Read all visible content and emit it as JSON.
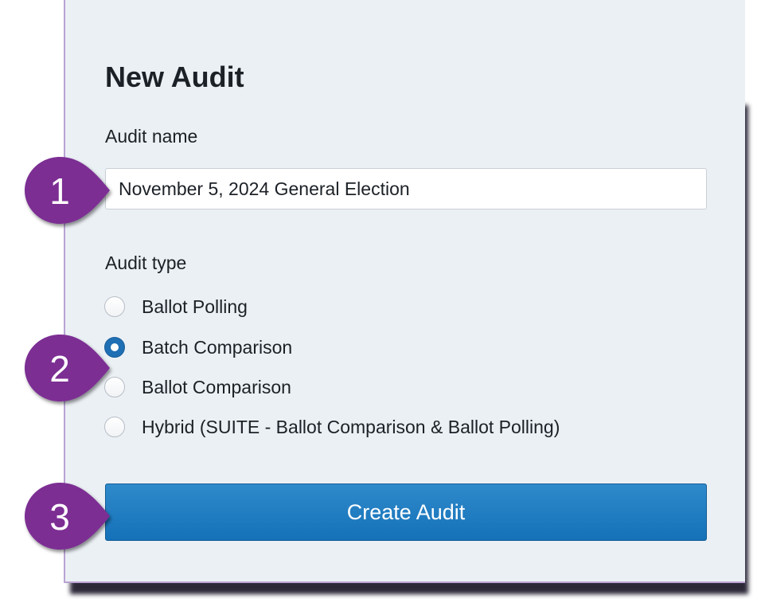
{
  "form": {
    "title": "New Audit",
    "name_label": "Audit name",
    "name_value": "November 5, 2024 General Election",
    "type_label": "Audit type",
    "audit_types": [
      {
        "label": "Ballot Polling",
        "checked": false
      },
      {
        "label": "Batch Comparison",
        "checked": true
      },
      {
        "label": "Ballot Comparison",
        "checked": false
      },
      {
        "label": "Hybrid (SUITE - Ballot Comparison & Ballot Polling)",
        "checked": false
      }
    ],
    "submit_label": "Create Audit"
  },
  "callouts": [
    "1",
    "2",
    "3"
  ],
  "colors": {
    "panel_bg": "#ebf0f5",
    "accent": "#1e6fb4",
    "callout": "#7b2f93",
    "button": "#1b76bc"
  }
}
